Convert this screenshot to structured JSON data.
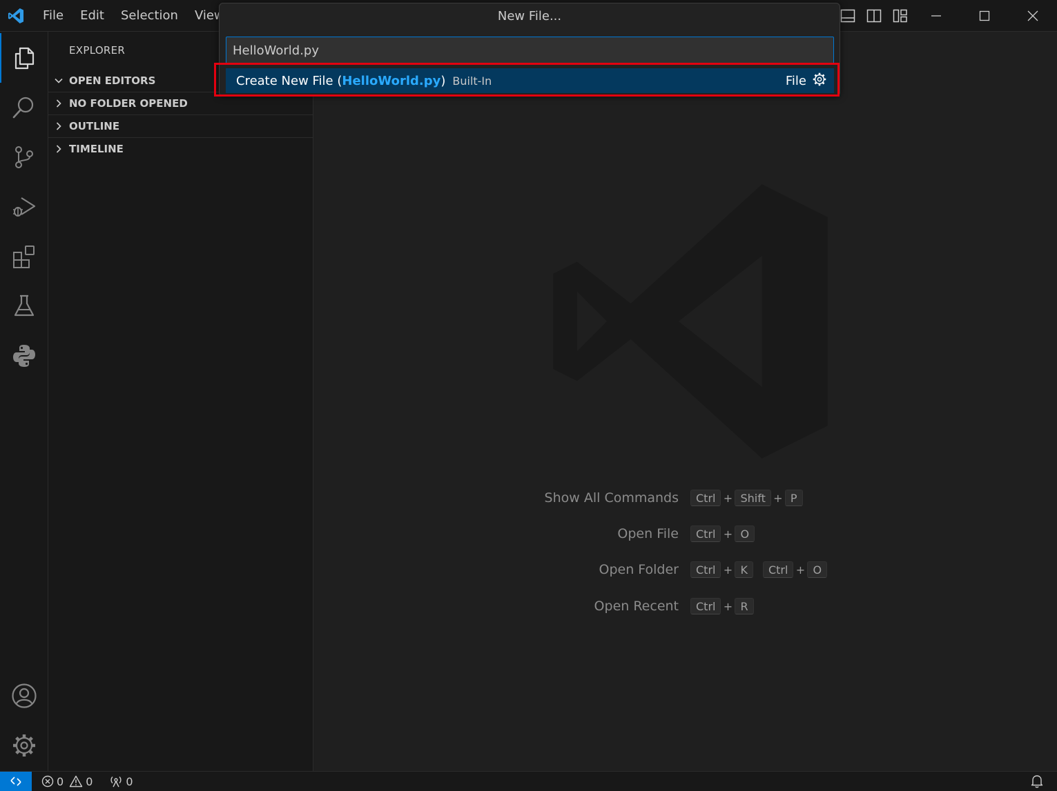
{
  "menu": {
    "items": [
      "File",
      "Edit",
      "Selection",
      "View"
    ]
  },
  "sidebar": {
    "title": "EXPLORER",
    "sections": [
      {
        "label": "OPEN EDITORS",
        "expanded": true
      },
      {
        "label": "NO FOLDER OPENED",
        "expanded": false
      },
      {
        "label": "OUTLINE",
        "expanded": false
      },
      {
        "label": "TIMELINE",
        "expanded": false
      }
    ]
  },
  "quick_input": {
    "title": "New File...",
    "value": "HelloWorld.py",
    "row": {
      "prefix": "Create New File (",
      "highlight": "HelloWorld.py",
      "suffix": ")",
      "description": "Built-In",
      "kind": "File"
    }
  },
  "shortcuts": [
    {
      "label": "Show All Commands",
      "keys": [
        [
          "Ctrl",
          "Shift",
          "P"
        ]
      ]
    },
    {
      "label": "Open File",
      "keys": [
        [
          "Ctrl",
          "O"
        ]
      ]
    },
    {
      "label": "Open Folder",
      "keys": [
        [
          "Ctrl",
          "K"
        ],
        [
          "Ctrl",
          "O"
        ]
      ]
    },
    {
      "label": "Open Recent",
      "keys": [
        [
          "Ctrl",
          "R"
        ]
      ]
    }
  ],
  "status": {
    "errors": "0",
    "warnings": "0",
    "ports": "0"
  },
  "colors": {
    "accent": "#0078d4",
    "highlight_border": "#e3000f",
    "selected_row": "#04395e",
    "match_text": "#2aaaff"
  }
}
